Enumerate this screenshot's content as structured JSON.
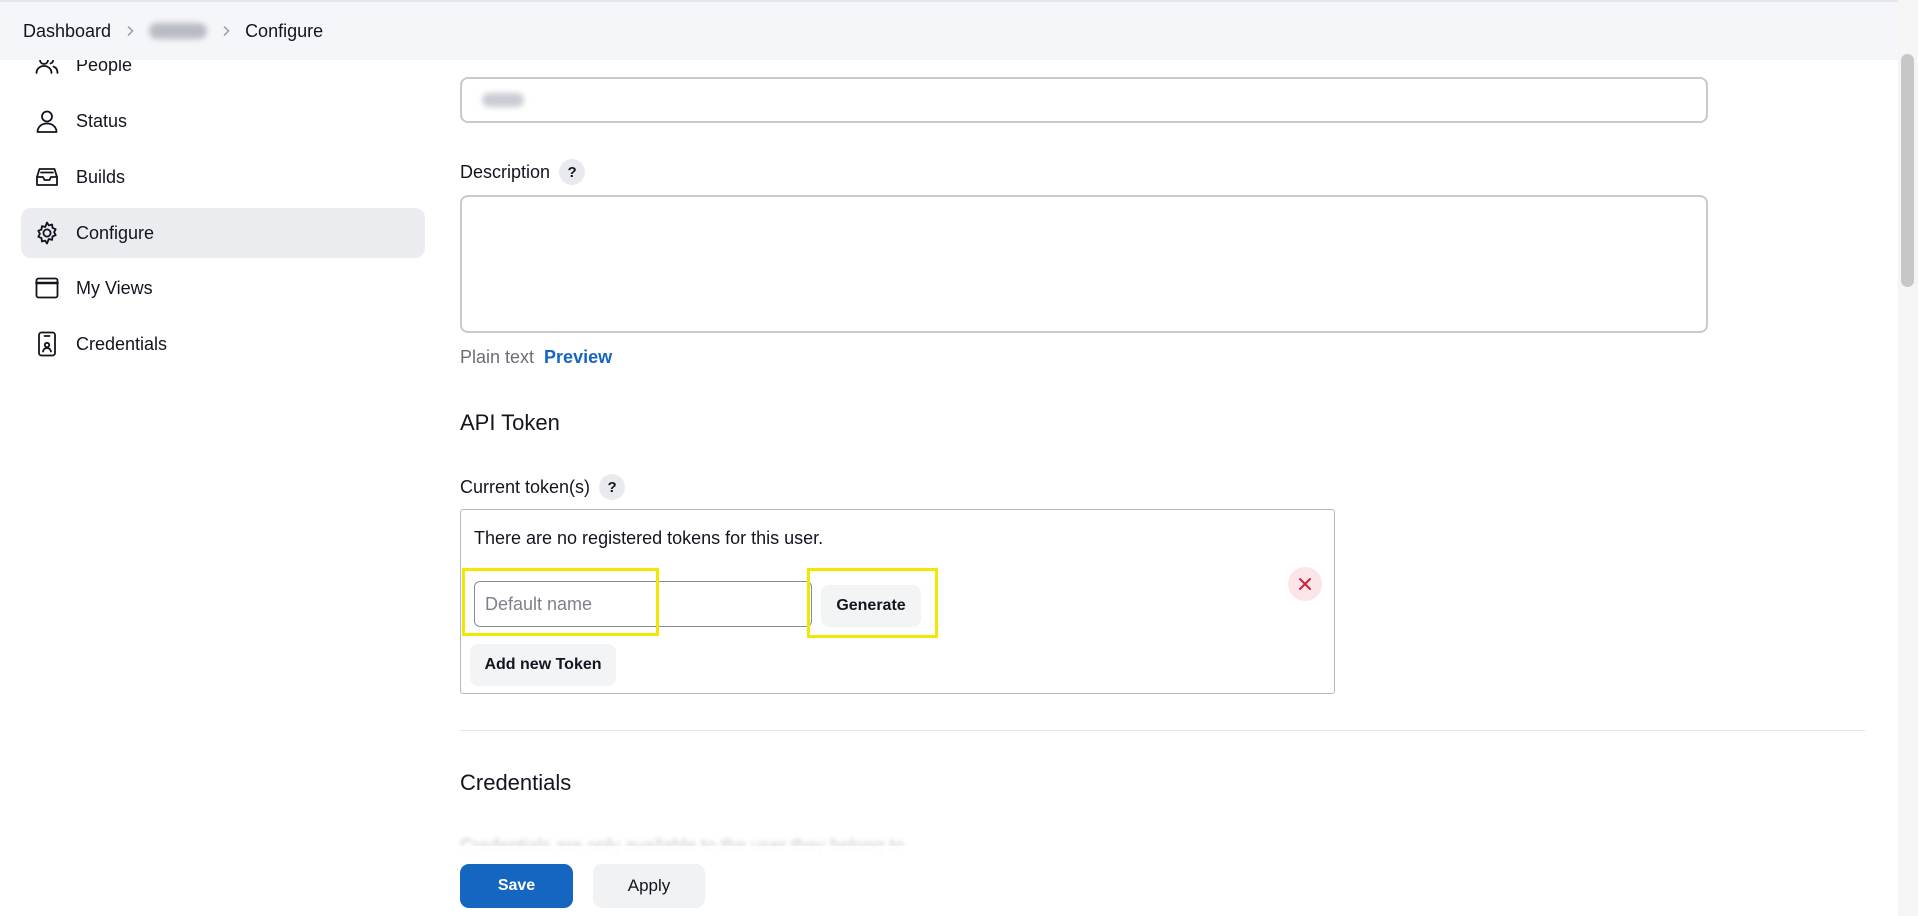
{
  "breadcrumb": {
    "items": [
      "Dashboard",
      "",
      "Configure"
    ]
  },
  "sidebar": {
    "items": [
      {
        "label": "People",
        "icon": "people-icon"
      },
      {
        "label": "Status",
        "icon": "user-icon"
      },
      {
        "label": "Builds",
        "icon": "inbox-icon"
      },
      {
        "label": "Configure",
        "icon": "gear-icon",
        "active": true
      },
      {
        "label": "My Views",
        "icon": "window-icon"
      },
      {
        "label": "Credentials",
        "icon": "id-card-icon"
      }
    ]
  },
  "form": {
    "description_label": "Description",
    "help_glyph": "?",
    "plain_text": "Plain text",
    "preview_link": "Preview"
  },
  "api_token": {
    "title": "API Token",
    "current_tokens_label": "Current token(s)",
    "empty_message": "There are no registered tokens for this user.",
    "name_placeholder": "Default name",
    "generate_label": "Generate",
    "add_token_label": "Add new Token"
  },
  "credentials": {
    "title": "Credentials",
    "note": "Credentials are only available to the user they belong to"
  },
  "actions": {
    "save_label": "Save",
    "apply_label": "Apply"
  },
  "colors": {
    "primary": "#1566c0",
    "highlight": "#f3e600",
    "remove": "#d0243c"
  }
}
